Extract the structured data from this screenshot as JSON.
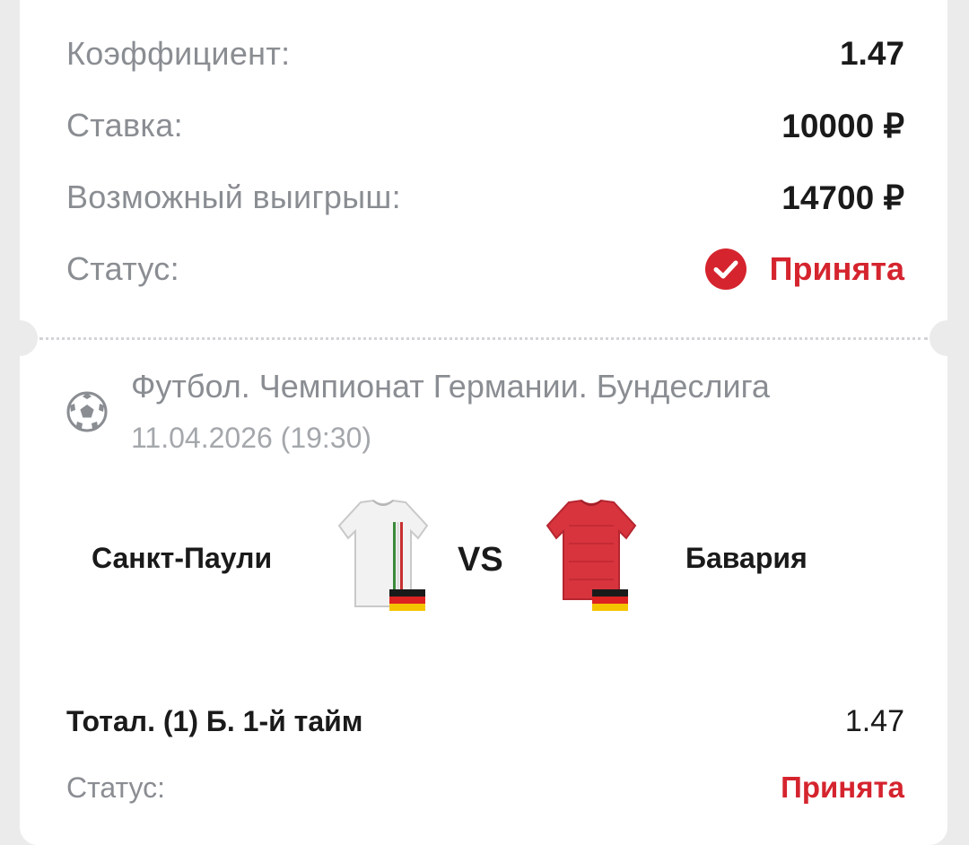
{
  "summary": {
    "coef_label": "Коэффициент:",
    "coef_value": "1.47",
    "stake_label": "Ставка:",
    "stake_value": "10000 ₽",
    "win_label": "Возможный выигрыш:",
    "win_value": "14700 ₽",
    "status_label": "Статус:",
    "status_value": "Принята",
    "status_icon": "check-circle-icon"
  },
  "event": {
    "league": "Футбол. Чемпионат Германии. Бундеслига",
    "datetime": "11.04.2026 (19:30)",
    "sport_icon": "soccer-ball-icon",
    "home_team": "Санкт-Паули",
    "away_team": "Бавария",
    "vs_label": "VS",
    "home_country_flag": "germany-flag-icon",
    "away_country_flag": "germany-flag-icon"
  },
  "selection": {
    "market": "Тотал. (1) Б. 1-й тайм",
    "coef": "1.47",
    "status_label": "Статус:",
    "status_value": "Принята"
  },
  "colors": {
    "accent_red": "#d5242e",
    "label_gray": "#8a8d92",
    "text_dark": "#1a1a1a",
    "background": "#ebebeb",
    "card": "#ffffff"
  }
}
